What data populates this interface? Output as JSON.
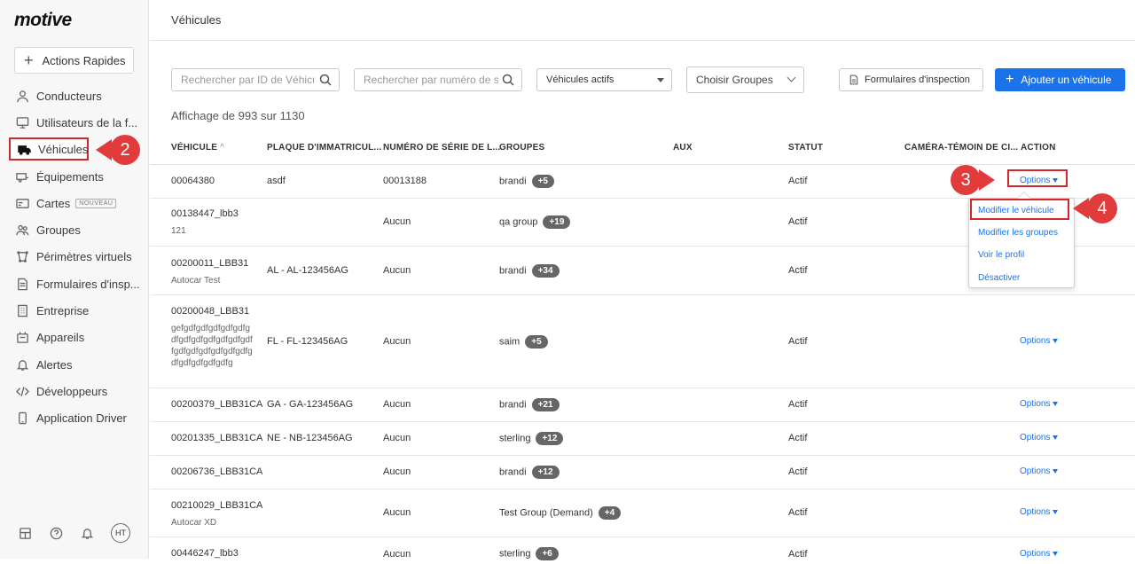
{
  "brand": {
    "logo": "motive"
  },
  "sidebar": {
    "quick_actions": "Actions Rapides",
    "items": [
      {
        "label": "Conducteurs",
        "icon": "user-icon"
      },
      {
        "label": "Utilisateurs de la f...",
        "icon": "monitor-icon"
      },
      {
        "label": "Véhicules",
        "icon": "truck-icon"
      },
      {
        "label": "Équipements",
        "icon": "trailer-icon"
      },
      {
        "label": "Cartes",
        "icon": "card-icon",
        "badge": "NOUVEAU"
      },
      {
        "label": "Groupes",
        "icon": "group-icon"
      },
      {
        "label": "Périmètres virtuels",
        "icon": "geofence-icon"
      },
      {
        "label": "Formulaires d'insp...",
        "icon": "document-icon"
      },
      {
        "label": "Entreprise",
        "icon": "building-icon"
      },
      {
        "label": "Appareils",
        "icon": "devices-icon"
      },
      {
        "label": "Alertes",
        "icon": "bell-icon"
      },
      {
        "label": "Développeurs",
        "icon": "code-icon"
      },
      {
        "label": "Application Driver",
        "icon": "phone-icon"
      }
    ],
    "footer": {
      "avatar": "HT"
    }
  },
  "header": {
    "title": "Véhicules"
  },
  "filters": {
    "search_id_placeholder": "Rechercher par ID de Véhicule",
    "search_serial_placeholder": "Rechercher par numéro de série",
    "status_select": "Véhicules actifs",
    "groups_select": "Choisir Groupes",
    "inspection_button": "Formulaires d'inspection",
    "add_button": "Ajouter un véhicule"
  },
  "count_text": "Affichage de 993 sur 1130",
  "table": {
    "columns": [
      "VÉHICULE",
      "PLAQUE D'IMMATRICUL...",
      "NUMÉRO DE SÉRIE DE L...",
      "GROUPES",
      "AUX",
      "STATUT",
      "CAMÉRA-TÉMOIN DE CI...",
      "ACTION"
    ],
    "rows": [
      {
        "vehicle": "00064380",
        "sub": "",
        "plate": "asdf",
        "serial": "00013188",
        "group": "brandi",
        "more": "+5",
        "status": "Actif",
        "action": "Options"
      },
      {
        "vehicle": "00138447_lbb3",
        "sub": "121",
        "plate": "",
        "serial": "Aucun",
        "group": "qa group",
        "more": "+19",
        "status": "Actif",
        "action": ""
      },
      {
        "vehicle": "00200011_LBB31",
        "sub": "Autocar Test",
        "plate": "AL - AL-123456AG",
        "serial": "Aucun",
        "group": "brandi",
        "more": "+34",
        "status": "Actif",
        "action": ""
      },
      {
        "vehicle": "00200048_LBB31",
        "sub": "gefgdfgdfgdfgdfgdfg\ndfgdfgdfgdfgdfgdfgdf\nfgdfgdfgdfgdfgdfgdfg\ndfgdfgdfgdfgdfg",
        "plate": "FL - FL-123456AG",
        "serial": "Aucun",
        "group": "saim",
        "more": "+5",
        "status": "Actif",
        "action": "Options"
      },
      {
        "vehicle": "00200379_LBB31CA",
        "sub": "",
        "plate": "GA - GA-123456AG",
        "serial": "Aucun",
        "group": "brandi",
        "more": "+21",
        "status": "Actif",
        "action": "Options"
      },
      {
        "vehicle": "00201335_LBB31CA",
        "sub": "",
        "plate": "NE - NB-123456AG",
        "serial": "Aucun",
        "group": "sterling",
        "more": "+12",
        "status": "Actif",
        "action": "Options"
      },
      {
        "vehicle": "00206736_LBB31CA",
        "sub": "",
        "plate": "",
        "serial": "Aucun",
        "group": "brandi",
        "more": "+12",
        "status": "Actif",
        "action": "Options"
      },
      {
        "vehicle": "00210029_LBB31CA",
        "sub": "Autocar XD",
        "plate": "",
        "serial": "Aucun",
        "group": "Test Group (Demand)",
        "more": "+4",
        "status": "Actif",
        "action": "Options"
      },
      {
        "vehicle": "00446247_lbb3",
        "sub": "",
        "plate": "",
        "serial": "Aucun",
        "group": "sterling",
        "more": "+6",
        "status": "Actif",
        "action": "Options"
      }
    ]
  },
  "options_menu": [
    "Modifier le véhicule",
    "Modifier les groupes",
    "Voir le profil",
    "Désactiver"
  ],
  "callouts": [
    "2",
    "3",
    "4"
  ]
}
